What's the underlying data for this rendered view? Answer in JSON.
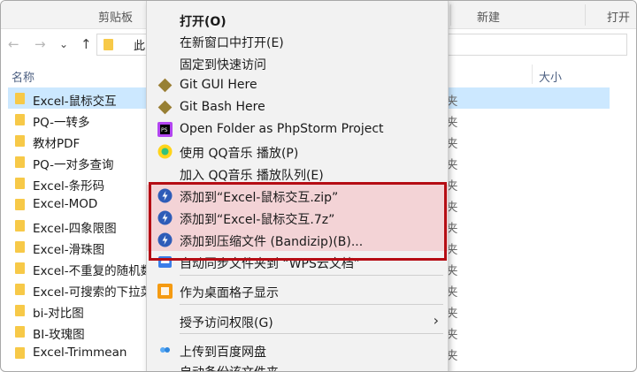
{
  "ribbon": {
    "groups": [
      "剪贴板",
      "新建",
      "打开"
    ]
  },
  "address": {
    "path_text": "此"
  },
  "columns": {
    "name": "名称",
    "size": "大小"
  },
  "files": [
    {
      "name": "Excel-鼠标交互",
      "type": "夹",
      "selected": true
    },
    {
      "name": "PQ-一转多",
      "type": "夹"
    },
    {
      "name": "教材PDF",
      "type": "夹"
    },
    {
      "name": "PQ-一对多查询",
      "type": "夹"
    },
    {
      "name": "Excel-条形码",
      "type": "夹"
    },
    {
      "name": "Excel-MOD",
      "type": "夹"
    },
    {
      "name": "Excel-四象限图",
      "type": "夹"
    },
    {
      "name": "Excel-滑珠图",
      "type": "夹"
    },
    {
      "name": "Excel-不重复的随机数",
      "type": "夹"
    },
    {
      "name": "Excel-可搜索的下拉菜单",
      "type": "夹"
    },
    {
      "name": "bi-对比图",
      "type": "夹"
    },
    {
      "name": "BI-玫瑰图",
      "type": "夹"
    },
    {
      "name": "Excel-Trimmean",
      "type": "夹"
    }
  ],
  "context_menu": {
    "items": [
      {
        "label": "打开(O)",
        "icon": "none"
      },
      {
        "label": "在新窗口中打开(E)",
        "icon": "none"
      },
      {
        "label": "固定到快速访问",
        "icon": "none"
      },
      {
        "label": "Git GUI Here",
        "icon": "git-icon"
      },
      {
        "label": "Git Bash Here",
        "icon": "git-icon"
      },
      {
        "label": "Open Folder as PhpStorm Project",
        "icon": "phpstorm-icon"
      },
      {
        "label": "使用 QQ音乐 播放(P)",
        "icon": "qqmusic-icon"
      },
      {
        "label": "加入 QQ音乐 播放队列(E)",
        "icon": "none"
      },
      {
        "label": "添加到“Excel-鼠标交互.zip”",
        "icon": "bandizip-icon"
      },
      {
        "label": "添加到“Excel-鼠标交互.7z”",
        "icon": "bandizip-icon"
      },
      {
        "label": "添加到压缩文件 (Bandizip)(B)...",
        "icon": "bandizip-icon"
      },
      {
        "label": "自动同步文件夹到 “WPS云文档”",
        "icon": "wps-cloud-icon"
      },
      {
        "label": "作为桌面格子显示",
        "icon": "desktop-grid-icon"
      },
      {
        "label": "授予访问权限(G)",
        "icon": "none"
      },
      {
        "label": "上传到百度网盘",
        "icon": "baidu-cloud-icon"
      },
      {
        "label": "自动备份该文件夹",
        "icon": "none"
      }
    ]
  },
  "colors": {
    "highlight_border": "#b50d14",
    "highlight_fill": "#f3d3d6",
    "selection": "#cce8ff"
  }
}
